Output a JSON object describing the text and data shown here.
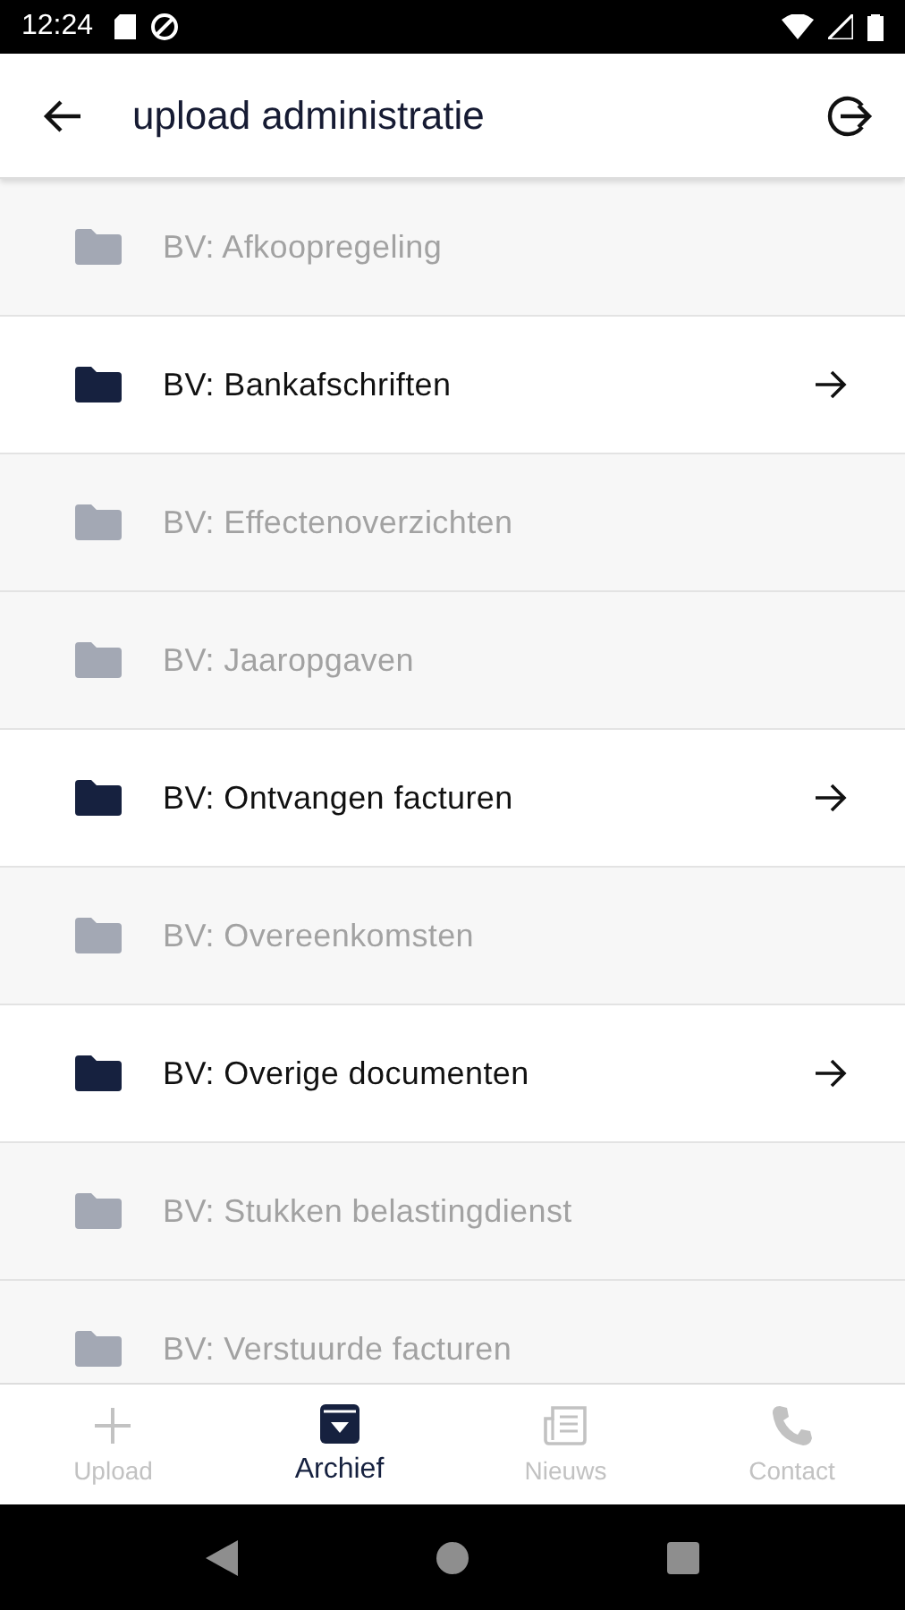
{
  "status_bar": {
    "time": "12:24"
  },
  "app_bar": {
    "title": "upload administratie"
  },
  "folders": [
    {
      "label": "BV: Afkoopregeling",
      "disabled": true
    },
    {
      "label": "BV: Bankafschriften",
      "disabled": false
    },
    {
      "label": "BV: Effectenoverzichten",
      "disabled": true
    },
    {
      "label": "BV: Jaaropgaven",
      "disabled": true
    },
    {
      "label": "BV: Ontvangen facturen",
      "disabled": false
    },
    {
      "label": "BV: Overeenkomsten",
      "disabled": true
    },
    {
      "label": "BV: Overige documenten",
      "disabled": false
    },
    {
      "label": "BV: Stukken belastingdienst",
      "disabled": true
    },
    {
      "label": "BV: Verstuurde facturen",
      "disabled": true
    }
  ],
  "bottom_nav": [
    {
      "label": "Upload",
      "kind": "plus",
      "selected": false
    },
    {
      "label": "Archief",
      "kind": "archive",
      "selected": true
    },
    {
      "label": "Nieuws",
      "kind": "news",
      "selected": false
    },
    {
      "label": "Contact",
      "kind": "phone",
      "selected": false
    }
  ]
}
